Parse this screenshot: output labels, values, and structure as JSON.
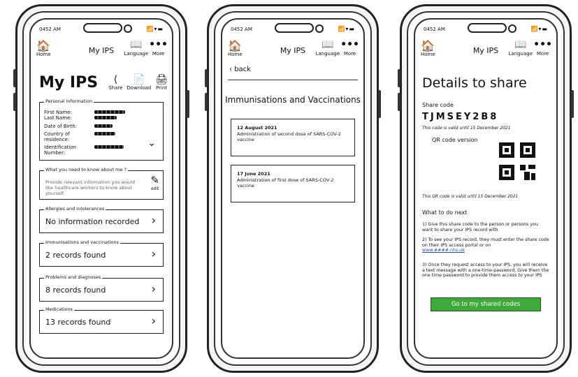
{
  "status": {
    "time": "0452 AM",
    "icons": "📶▾▬"
  },
  "nav": {
    "home_label": "Home",
    "home_icon": "🏠",
    "title": "My IPS",
    "language_label": "Language",
    "language_icon": "📖",
    "more_label": "More",
    "more_icon": "•••"
  },
  "screen1": {
    "title": "My IPS",
    "actions": [
      {
        "label": "Share",
        "icon": "⟨"
      },
      {
        "label": "Download",
        "icon": "📄"
      },
      {
        "label": "Print",
        "icon": "🖨"
      }
    ],
    "personal": {
      "legend": "Personal information",
      "fields": [
        "First Name:",
        "Last Name:",
        "Date of Birth:",
        "Country of residence:",
        "Identification Number:"
      ],
      "chevron": "⌄"
    },
    "about": {
      "legend": "What you need to know about me ?",
      "placeholder": "Provide relevant information you would like healthcare workers to know about yourself.",
      "edit_label": "edit",
      "edit_icon": "✎"
    },
    "sections": [
      {
        "legend": "Allergies and intolerances",
        "value": "No information recorded"
      },
      {
        "legend": "Immunisations and vaccinations",
        "value": "2 records found"
      },
      {
        "legend": "Problems and diagnoses",
        "value": "8 records found"
      },
      {
        "legend": "Medications",
        "value": "13 records found"
      }
    ],
    "chevron": "›"
  },
  "screen2": {
    "back_label": "back",
    "title": "Immunisations and Vaccinations",
    "entries": [
      {
        "date": "12 August 2021",
        "text": "Administration of second dose of SARS-COV-2 vaccine"
      },
      {
        "date": "17 June 2021",
        "text": "Administration of first dose of  SARS-COV-2 vaccine"
      }
    ]
  },
  "screen3": {
    "title": "Details to share",
    "share_code_label": "Share code",
    "share_code": "TJMSEY2B8",
    "code_valid": "This code is valid until 15 December 2021",
    "qr_label": "QR code version",
    "qr_valid": "This QR code is valid until 15 December 2021",
    "next_label": "What to do next",
    "step1": "1) Give this share code to the person or persons you want to share your IPS record with.",
    "step2": "2) To see your IPS record, they must enter the share code on their IPS access portal or on",
    "step2_link": "www.####.nhs.uk",
    "step3": "3) Once they request access to your IPS, you will receive a text message with a one-time-password. Give them the one time password to provide them access to your IPS",
    "button": "Go to my shared codes"
  }
}
